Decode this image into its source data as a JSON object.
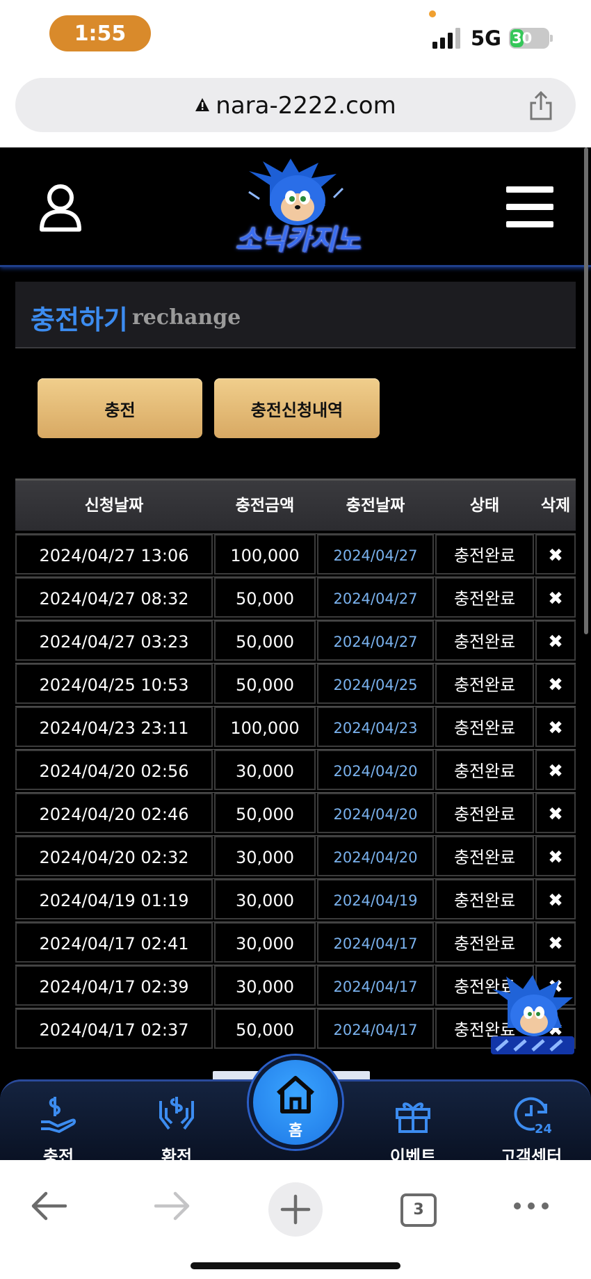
{
  "status_bar": {
    "time": "1:55",
    "network": "5G",
    "battery": "30"
  },
  "browser": {
    "url": "nara-2222.com",
    "tab_count": "3"
  },
  "site": {
    "logo_text": "소닉카지노",
    "title_ko": "충전하기",
    "title_en": "rechange",
    "buttons": {
      "charge": "충전",
      "history": "충전신청내역"
    }
  },
  "table": {
    "headers": [
      "신청날짜",
      "충전금액",
      "충전날짜",
      "상태",
      "삭제"
    ],
    "rows": [
      {
        "request_date": "2024/04/27 13:06",
        "amount": "100,000",
        "charge_date": "2024/04/27",
        "status": "충전완료",
        "delete": "✖"
      },
      {
        "request_date": "2024/04/27 08:32",
        "amount": "50,000",
        "charge_date": "2024/04/27",
        "status": "충전완료",
        "delete": "✖"
      },
      {
        "request_date": "2024/04/27 03:23",
        "amount": "50,000",
        "charge_date": "2024/04/27",
        "status": "충전완료",
        "delete": "✖"
      },
      {
        "request_date": "2024/04/25 10:53",
        "amount": "50,000",
        "charge_date": "2024/04/25",
        "status": "충전완료",
        "delete": "✖"
      },
      {
        "request_date": "2024/04/23 23:11",
        "amount": "100,000",
        "charge_date": "2024/04/23",
        "status": "충전완료",
        "delete": "✖"
      },
      {
        "request_date": "2024/04/20 02:56",
        "amount": "30,000",
        "charge_date": "2024/04/20",
        "status": "충전완료",
        "delete": "✖"
      },
      {
        "request_date": "2024/04/20 02:46",
        "amount": "50,000",
        "charge_date": "2024/04/20",
        "status": "충전완료",
        "delete": "✖"
      },
      {
        "request_date": "2024/04/20 02:32",
        "amount": "30,000",
        "charge_date": "2024/04/20",
        "status": "충전완료",
        "delete": "✖"
      },
      {
        "request_date": "2024/04/19 01:19",
        "amount": "30,000",
        "charge_date": "2024/04/19",
        "status": "충전완료",
        "delete": "✖"
      },
      {
        "request_date": "2024/04/17 02:41",
        "amount": "30,000",
        "charge_date": "2024/04/17",
        "status": "충전완료",
        "delete": "✖"
      },
      {
        "request_date": "2024/04/17 02:39",
        "amount": "30,000",
        "charge_date": "2024/04/17",
        "status": "충전완료",
        "delete": "✖"
      },
      {
        "request_date": "2024/04/17 02:37",
        "amount": "50,000",
        "charge_date": "2024/04/17",
        "status": "충전완료",
        "delete": "✖"
      }
    ]
  },
  "tabbar": {
    "charge": "충전",
    "exchange": "환전",
    "home": "홈",
    "event": "이벤트",
    "support": "고객센터"
  },
  "colors": {
    "accent_blue": "#3c8cf0",
    "gold_button": "#e6bd78",
    "date_blue": "#7ab2ee",
    "background": "#000000"
  }
}
